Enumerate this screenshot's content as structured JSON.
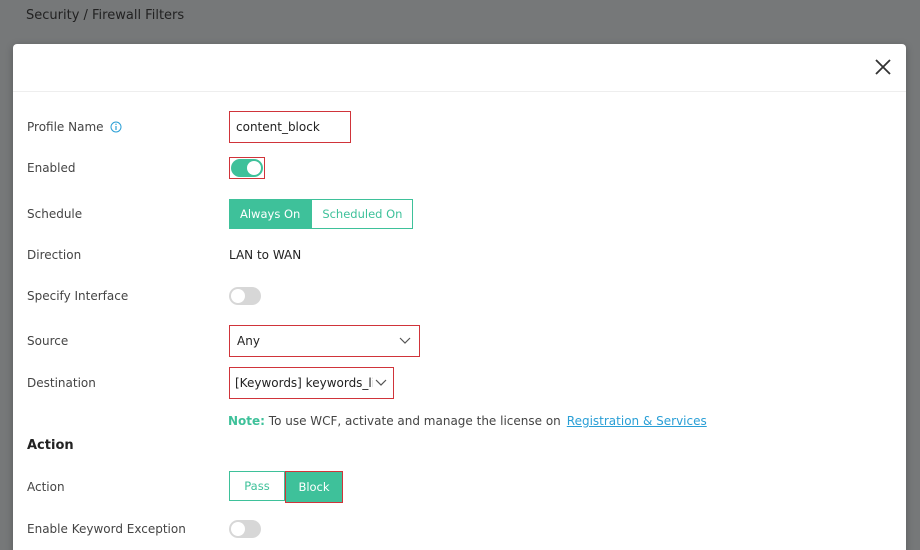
{
  "breadcrumb": "Security / Firewall Filters",
  "form": {
    "profile_name_label": "Profile Name",
    "profile_name_value": "content_block",
    "enabled_label": "Enabled",
    "schedule_label": "Schedule",
    "schedule_options": [
      "Always On",
      "Scheduled On"
    ],
    "direction_label": "Direction",
    "direction_value": "LAN to WAN",
    "specify_interface_label": "Specify Interface",
    "source_label": "Source",
    "source_value": "Any",
    "destination_label": "Destination",
    "destination_value": "[Keywords] keywords_list",
    "note_label": "Note:",
    "note_text": " To use WCF, activate and manage the license on",
    "note_link": "Registration & Services",
    "action_section_title": "Action",
    "action_label": "Action",
    "action_options": [
      "Pass",
      "Block"
    ],
    "enable_keyword_exception_label": "Enable Keyword Exception"
  },
  "colors": {
    "accent": "#3ec19a",
    "highlight_border": "#d0343a",
    "link": "#2a9fd6",
    "overlay": "#767879"
  },
  "icons": {
    "close": "close-icon",
    "info": "info-icon",
    "chevron": "chevron-down-icon"
  }
}
